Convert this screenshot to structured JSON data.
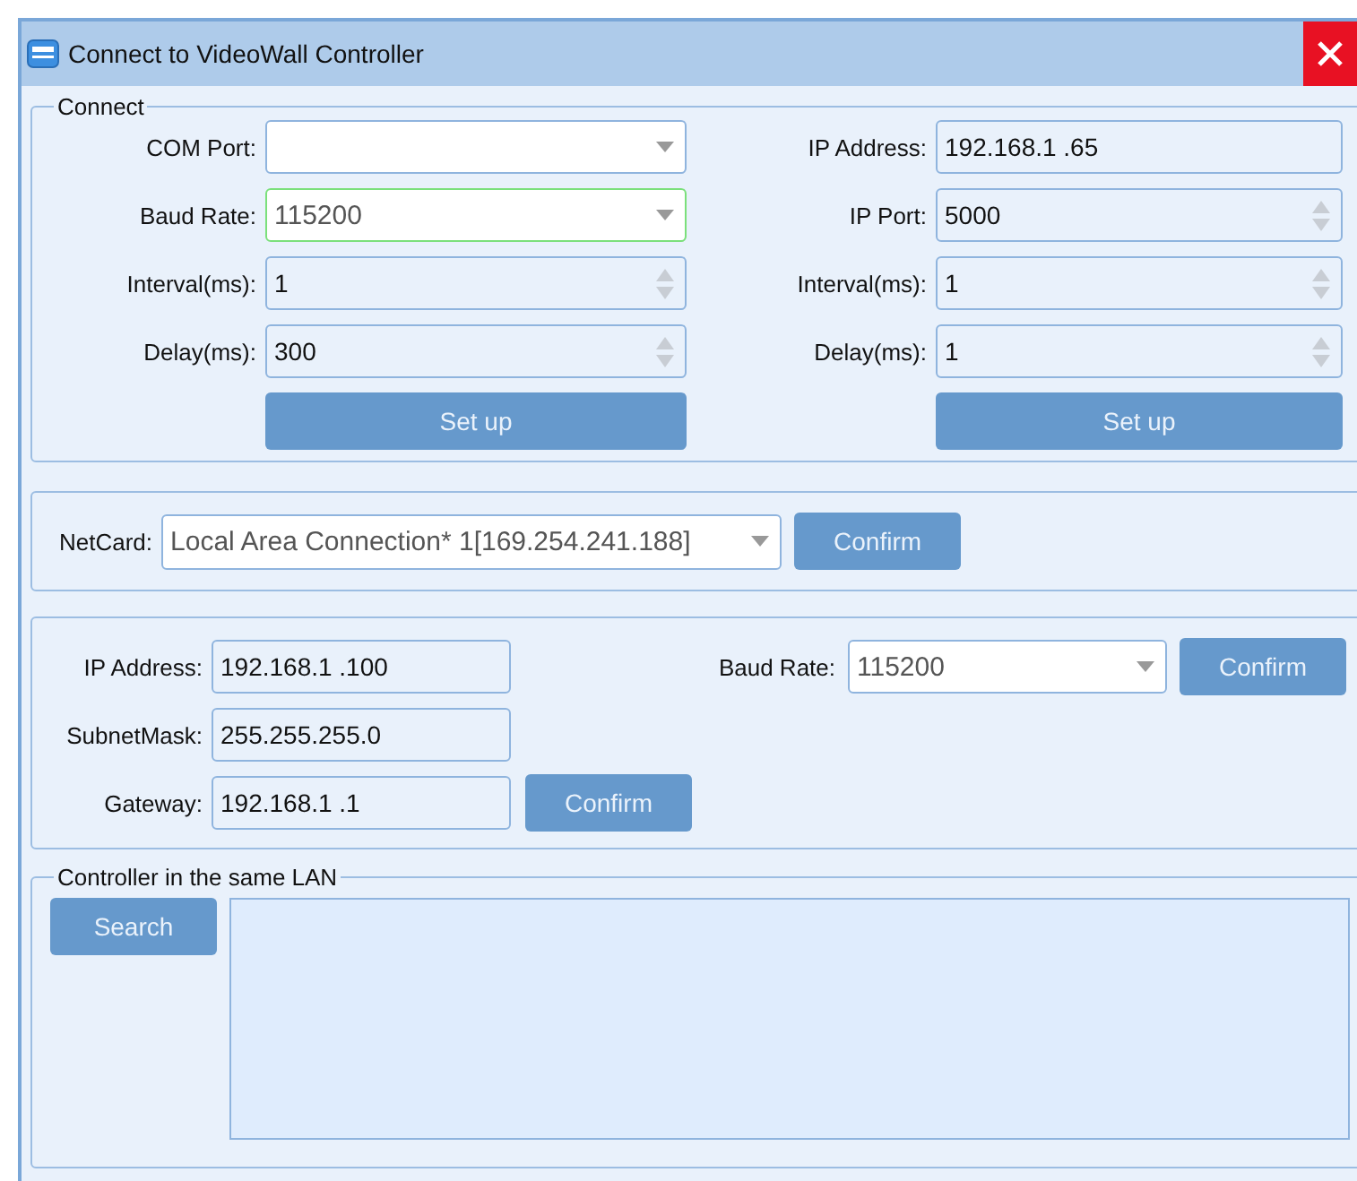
{
  "window": {
    "title": "Connect to VideoWall Controller"
  },
  "connect": {
    "legend": "Connect",
    "serial": {
      "fields": [
        {
          "label": "COM Port:",
          "kind": "combo",
          "focused": false
        },
        {
          "label": "Baud Rate:",
          "kind": "combo",
          "value": "115200",
          "focused": true
        },
        {
          "label": "Interval(ms):",
          "kind": "spin",
          "value": "1",
          "focused": false
        },
        {
          "label": "Delay(ms):",
          "kind": "spin",
          "value": "300",
          "focused": false
        }
      ],
      "button": "Set up"
    },
    "network": {
      "fields": [
        {
          "label": "IP Address:",
          "kind": "text",
          "value": "192.168.1  .65",
          "focused": false
        },
        {
          "label": "IP Port:",
          "kind": "spin",
          "value": "5000",
          "focused": false
        },
        {
          "label": "Interval(ms):",
          "kind": "spin",
          "value": "1",
          "focused": false
        },
        {
          "label": "Delay(ms):",
          "kind": "spin",
          "value": "1",
          "focused": false
        }
      ],
      "button": "Set up"
    }
  },
  "netcard": {
    "label": "NetCard:",
    "field": {
      "kind": "combo",
      "value": "Local Area Connection* 1[169.254.241.188]",
      "focused": false
    },
    "button": "Confirm"
  },
  "device": {
    "fields": [
      {
        "label": "IP Address:",
        "value": "192.168.1  .100",
        "focused": false
      },
      {
        "label": "SubnetMask:",
        "value": "255.255.255.0",
        "focused": false
      },
      {
        "label": "Gateway:",
        "value": "192.168.1  .1",
        "focused": false
      }
    ],
    "gateway_button": "Confirm",
    "baud": {
      "label": "Baud Rate:",
      "kind": "combo",
      "value": "115200",
      "focused": false
    },
    "baud_button": "Confirm"
  },
  "lan": {
    "legend": "Controller in the same LAN",
    "button": "Search"
  }
}
